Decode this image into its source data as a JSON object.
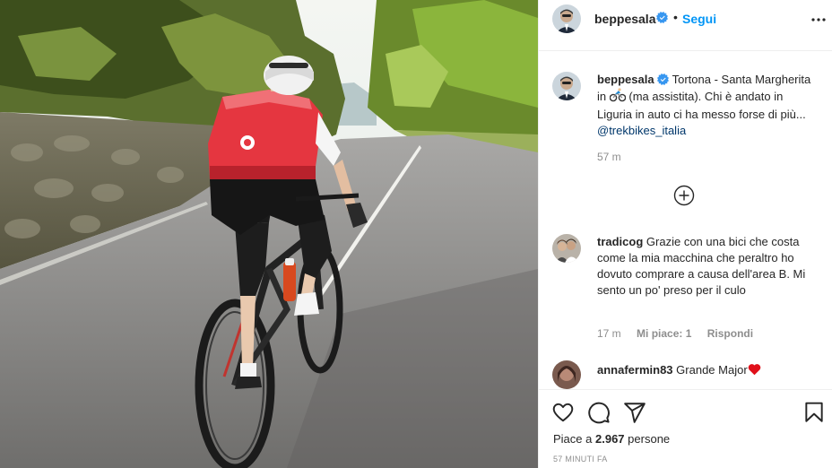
{
  "post": {
    "username": "beppesala",
    "follow_label": "Segui",
    "separator": "•",
    "caption": {
      "username": "beppesala",
      "text_before_emoji": "Tortona - Santa Margherita in",
      "emoji_icon": "bicyclist-emoji",
      "text_after_emoji": "(ma assistita). Chi è andato in Liguria in auto ci ha messo forse di più...",
      "mention": "@trekbikes_italia",
      "time": "57 m"
    },
    "comments": [
      {
        "username": "tradicog",
        "text": "Grazie con una bici che costa come la mia macchina che peraltro ho dovuto comprare a causa dell'area B. Mi sento un po' preso per il culo",
        "time": "17 m",
        "likes": "Mi piace: 1",
        "reply": "Rispondi"
      },
      {
        "username": "annafermin83",
        "text": "Grande Major",
        "emoji_icon": "red-heart-emoji"
      }
    ],
    "likes_text": "Piace a",
    "likes_count": "2.967",
    "likes_suffix": "persone",
    "time_ago": "57 minuti fa"
  },
  "colors": {
    "link_blue": "#0095f6",
    "mention_blue": "#00376b",
    "verified_blue": "#3897f0",
    "muted": "#8e8e8e",
    "text": "#262626"
  }
}
